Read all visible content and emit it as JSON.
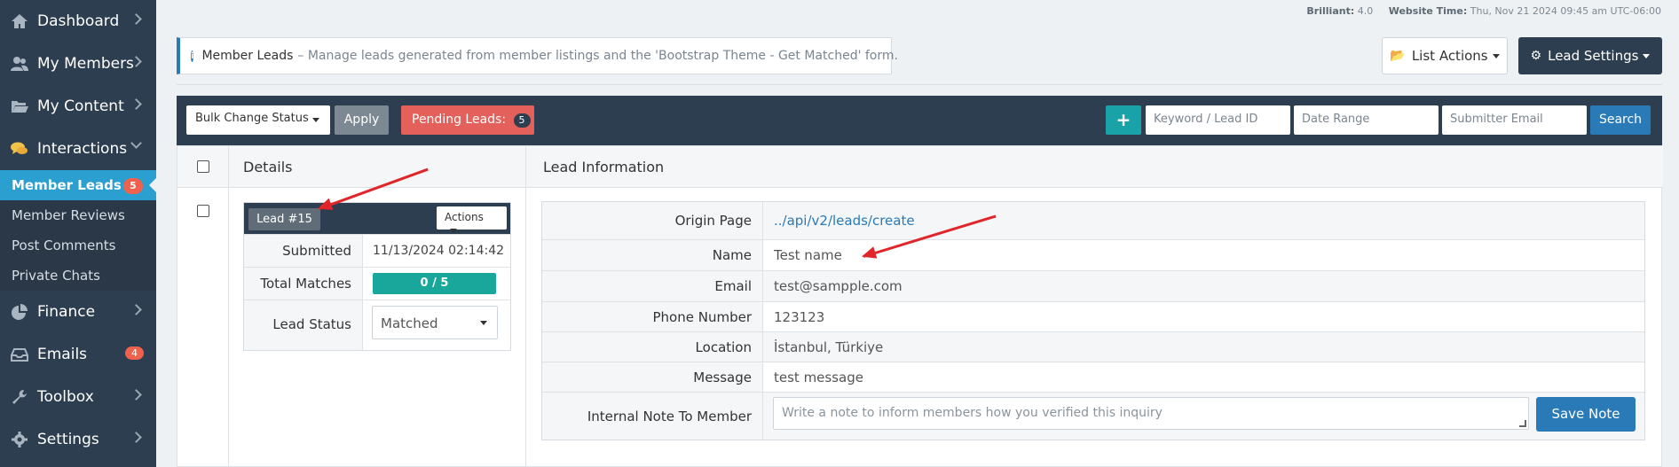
{
  "sidebar": {
    "items": [
      {
        "label": "Dashboard",
        "icon": "home-icon"
      },
      {
        "label": "My Members",
        "icon": "users-icon"
      },
      {
        "label": "My Content",
        "icon": "folder-icon"
      },
      {
        "label": "Interactions",
        "icon": "comments-icon"
      },
      {
        "label": "Finance",
        "icon": "pie-chart-icon"
      },
      {
        "label": "Emails",
        "icon": "inbox-icon",
        "badge": "4"
      },
      {
        "label": "Toolbox",
        "icon": "wrench-icon"
      },
      {
        "label": "Settings",
        "icon": "gear-icon"
      }
    ],
    "submenu": [
      {
        "label": "Member Leads",
        "badge": "5"
      },
      {
        "label": "Member Reviews"
      },
      {
        "label": "Post Comments"
      },
      {
        "label": "Private Chats"
      }
    ]
  },
  "status": {
    "brilliant_label": "Brilliant:",
    "brilliant_value": "4.0",
    "time_label": "Website Time:",
    "time_value": "Thu, Nov 21 2024 09:45 am UTC-06:00"
  },
  "alert": {
    "title": "Member Leads",
    "text": "– Manage leads generated from member listings and the 'Bootstrap Theme - Get Matched' form."
  },
  "top_buttons": {
    "list_actions": "List Actions",
    "lead_settings": "Lead Settings"
  },
  "toolbar": {
    "bulk_select": "Bulk Change Status",
    "apply": "Apply",
    "pending_label": "Pending Leads:",
    "pending_count": "5",
    "plus": "+",
    "keyword_placeholder": "Keyword / Lead ID",
    "date_placeholder": "Date Range",
    "email_placeholder": "Submitter Email",
    "search": "Search"
  },
  "panel": {
    "details_header": "Details",
    "info_header": "Lead Information"
  },
  "lead": {
    "tag": "Lead #15",
    "actions": "Actions",
    "submitted_label": "Submitted",
    "submitted_value": "11/13/2024 02:14:42",
    "matches_label": "Total Matches",
    "matches_value": "0 / 5",
    "status_label": "Lead Status",
    "status_value": "Matched"
  },
  "info": {
    "rows": [
      {
        "label": "Origin Page",
        "value": "../api/v2/leads/create"
      },
      {
        "label": "Name",
        "value": "Test name"
      },
      {
        "label": "Email",
        "value": "test@sampple.com"
      },
      {
        "label": "Phone Number",
        "value": "123123"
      },
      {
        "label": "Location",
        "value": "İstanbul, Türkiye"
      },
      {
        "label": "Message",
        "value": "test message"
      }
    ],
    "note_label": "Internal Note To Member",
    "note_placeholder": "Write a note to inform members how you verified this inquiry",
    "save_note": "Save Note"
  },
  "colors": {
    "sidebar_bg": "#2d3e50",
    "active_item": "#2c9fd1",
    "primary_button": "#2a7ab8",
    "pending_button": "#e4605a",
    "badge": "#f0624d",
    "match_bar": "#1aa79b",
    "annotation_arrow": "#e0262b"
  }
}
